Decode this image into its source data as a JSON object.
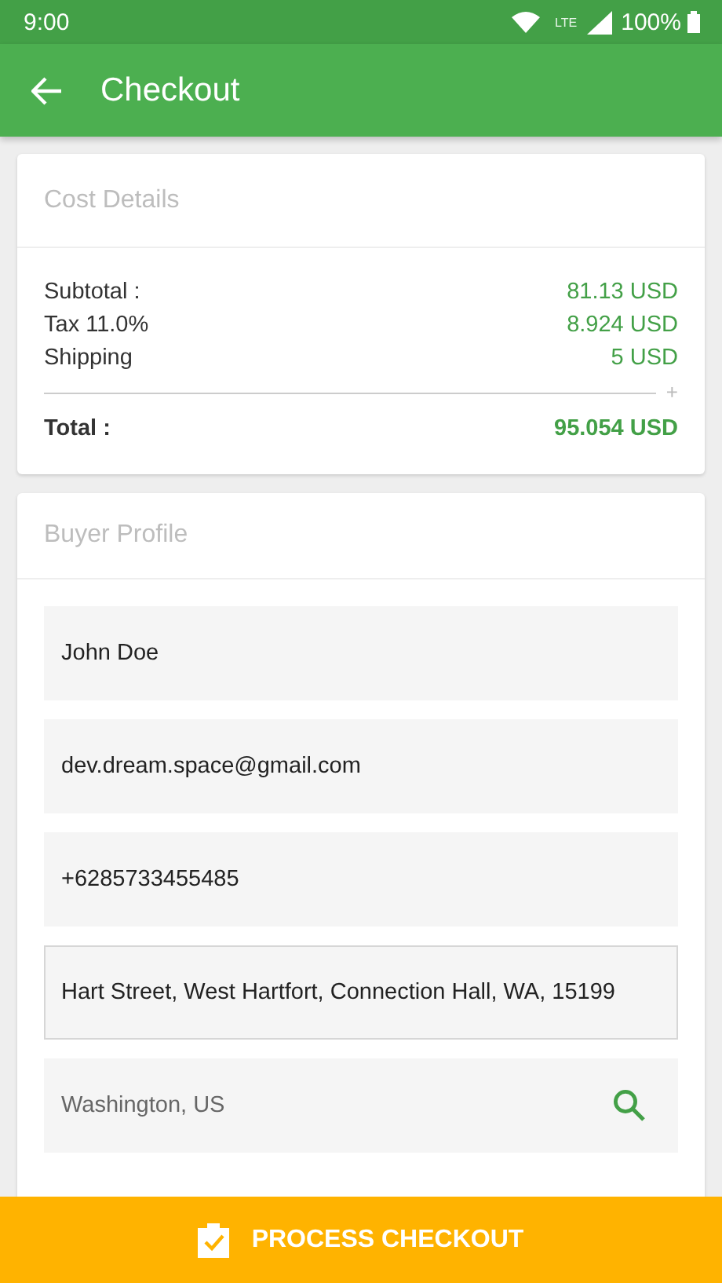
{
  "status_bar": {
    "time": "9:00",
    "network": "LTE",
    "battery": "100%"
  },
  "toolbar": {
    "title": "Checkout"
  },
  "cost_details": {
    "title": "Cost Details",
    "rows": [
      {
        "label": "Subtotal :",
        "value": "81.13 USD"
      },
      {
        "label": "Tax 11.0%",
        "value": "8.924 USD"
      },
      {
        "label": "Shipping",
        "value": "5 USD"
      }
    ],
    "divider_mark": "+",
    "total": {
      "label": "Total :",
      "value": "95.054 USD"
    }
  },
  "buyer_profile": {
    "title": "Buyer Profile",
    "fields": [
      {
        "kind": "text",
        "value": "John Doe"
      },
      {
        "kind": "text",
        "value": "dev.dream.space@gmail.com"
      },
      {
        "kind": "text",
        "value": "+6285733455485"
      },
      {
        "kind": "address",
        "value": "Hart Street, West Hartfort, Connection Hall, WA, 15199"
      },
      {
        "kind": "search",
        "value": "Washington, US"
      }
    ]
  },
  "action_button": {
    "label": "PROCESS CHECKOUT"
  }
}
